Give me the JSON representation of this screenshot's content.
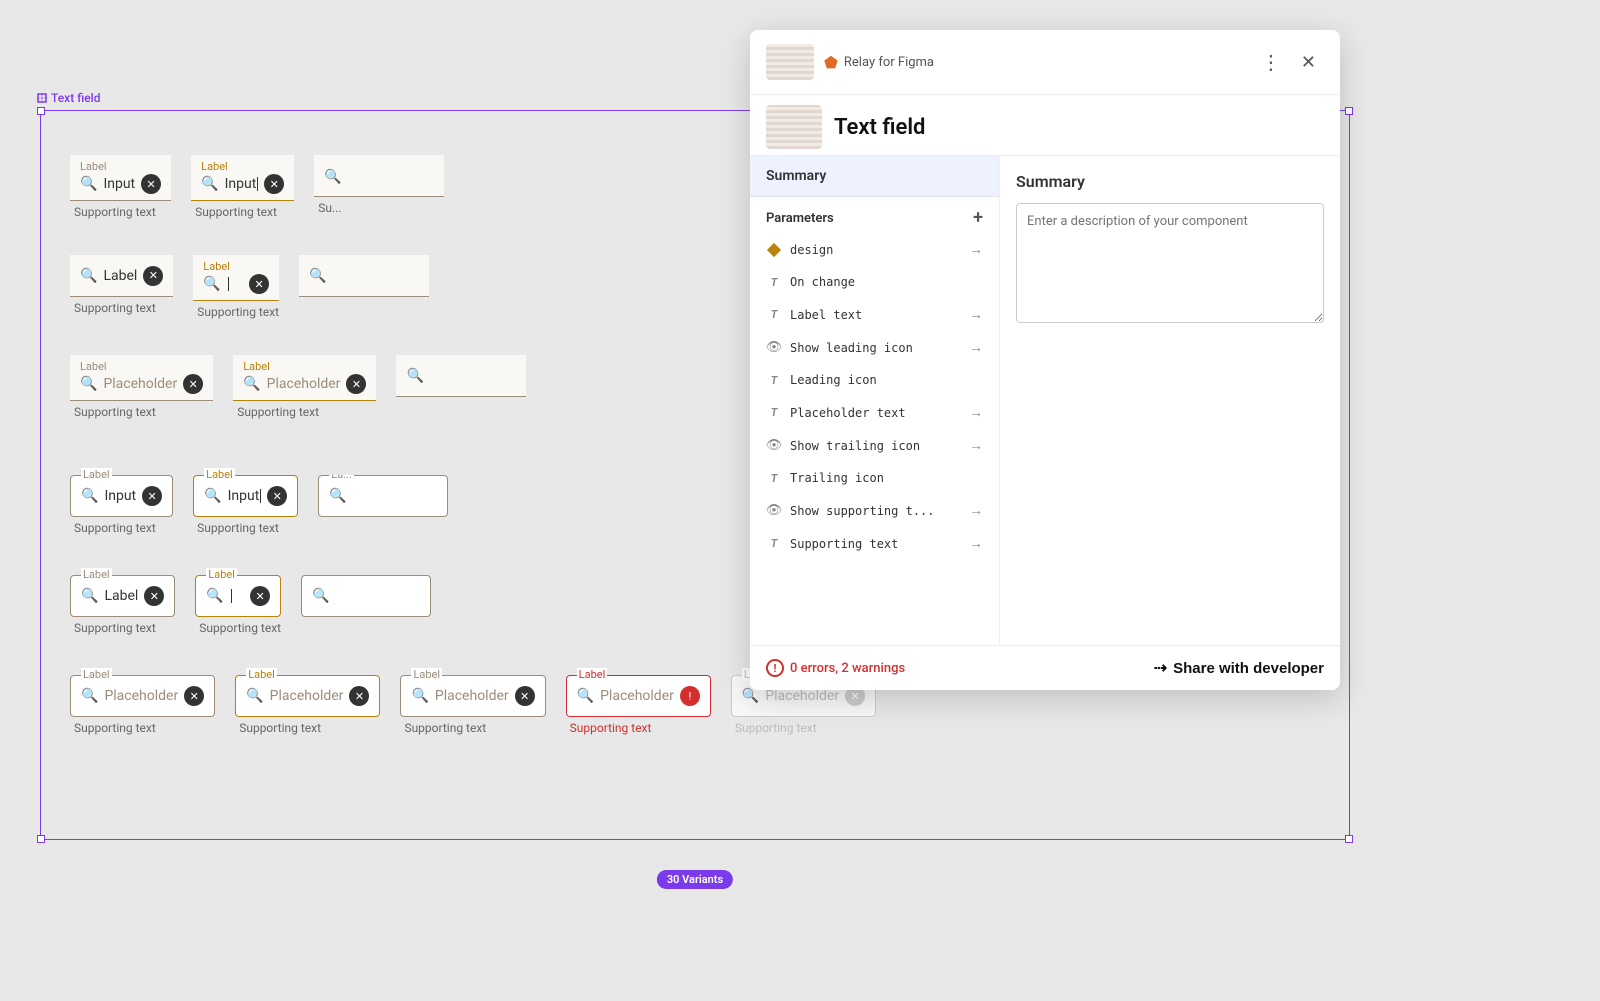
{
  "canvas": {
    "background": "#e8e8e8",
    "frame_label": "Text field"
  },
  "variants_badge": "30 Variants",
  "text_fields": {
    "rows": [
      {
        "row_index": 0,
        "fields": [
          {
            "type": "filled",
            "label": "Label",
            "value": "Input",
            "has_icon": true,
            "has_clear": true,
            "supporting": "Supporting text",
            "state": "default"
          },
          {
            "type": "filled",
            "label": "Label",
            "value": "Input",
            "has_icon": true,
            "has_clear": true,
            "supporting": "Supporting text",
            "state": "focused"
          },
          {
            "type": "filled",
            "label": "",
            "value": "Su...",
            "has_icon": true,
            "has_clear": true,
            "supporting": "",
            "state": "default",
            "truncated": true
          }
        ]
      },
      {
        "row_index": 1,
        "fields": [
          {
            "type": "filled",
            "label": "Label",
            "value": "Label",
            "has_icon": true,
            "has_clear": true,
            "supporting": "Supporting text",
            "state": "default"
          },
          {
            "type": "filled",
            "label": "Label",
            "value": "",
            "has_icon": true,
            "has_clear": true,
            "supporting": "Supporting text",
            "state": "focused"
          },
          {
            "type": "filled",
            "label": "",
            "value": "",
            "has_icon": true,
            "has_clear": true,
            "supporting": "",
            "state": "default",
            "truncated": true
          }
        ]
      },
      {
        "row_index": 2,
        "fields": [
          {
            "type": "filled",
            "label": "Label",
            "value": "Placeholder",
            "has_icon": true,
            "has_clear": true,
            "supporting": "Supporting text",
            "state": "default",
            "is_placeholder": true
          },
          {
            "type": "filled",
            "label": "Label",
            "value": "Placeholder",
            "has_icon": true,
            "has_clear": true,
            "supporting": "Supporting text",
            "state": "focused",
            "is_placeholder": true
          },
          {
            "type": "filled",
            "label": "",
            "value": "",
            "has_icon": true,
            "has_clear": true,
            "supporting": "",
            "state": "default",
            "truncated": true
          }
        ]
      },
      {
        "row_index": 3,
        "is_spacer": true
      },
      {
        "row_index": 4,
        "fields": [
          {
            "type": "outlined",
            "label": "Label",
            "value": "Input",
            "has_icon": true,
            "has_clear": true,
            "supporting": "Supporting text",
            "state": "default"
          },
          {
            "type": "outlined",
            "label": "Label",
            "value": "Input",
            "has_icon": true,
            "has_clear": true,
            "supporting": "Supporting text",
            "state": "focused"
          },
          {
            "type": "outlined",
            "label": "La...",
            "value": "",
            "has_icon": true,
            "has_clear": true,
            "supporting": "",
            "state": "default",
            "truncated": true
          }
        ]
      },
      {
        "row_index": 5,
        "fields": [
          {
            "type": "outlined",
            "label": "Label",
            "value": "Label",
            "has_icon": true,
            "has_clear": true,
            "supporting": "Supporting text",
            "state": "default"
          },
          {
            "type": "outlined",
            "label": "Label",
            "value": "",
            "has_icon": true,
            "has_clear": true,
            "supporting": "Supporting text",
            "state": "focused"
          },
          {
            "type": "outlined",
            "label": "",
            "value": "",
            "has_icon": true,
            "has_clear": true,
            "supporting": "",
            "state": "default",
            "truncated": true
          }
        ]
      },
      {
        "row_index": 6,
        "fields": [
          {
            "type": "outlined",
            "label": "Label",
            "value": "Placeholder",
            "has_icon": true,
            "has_clear": true,
            "supporting": "Supporting text",
            "state": "default",
            "is_placeholder": true
          },
          {
            "type": "outlined",
            "label": "Label",
            "value": "Placeholder",
            "has_icon": true,
            "has_clear": true,
            "supporting": "Supporting text",
            "state": "focused",
            "is_placeholder": true
          },
          {
            "type": "outlined",
            "label": "Label",
            "value": "Placeholder",
            "has_icon": true,
            "has_clear": true,
            "supporting": "Supporting text",
            "state": "default",
            "is_placeholder": true
          },
          {
            "type": "outlined",
            "label": "Label",
            "value": "Placeholder",
            "has_icon": true,
            "has_clear": true,
            "supporting": "Supporting text",
            "state": "error",
            "is_placeholder": true
          },
          {
            "type": "outlined",
            "label": "Label",
            "value": "Placeholder",
            "has_icon": true,
            "has_clear": true,
            "supporting": "Supporting text",
            "state": "disabled",
            "is_placeholder": true
          }
        ]
      }
    ]
  },
  "panel": {
    "title": "Text field",
    "menu_icon": "⋮",
    "close_icon": "✕",
    "relay_label": "Relay for Figma",
    "left_tab": "Summary",
    "params_title": "Parameters",
    "params_add_icon": "+",
    "params": [
      {
        "type": "diamond",
        "name": "design",
        "has_arrow": true
      },
      {
        "type": "text",
        "name": "On change",
        "has_arrow": false
      },
      {
        "type": "text",
        "name": "Label text",
        "has_arrow": true
      },
      {
        "type": "eye",
        "name": "Show leading icon",
        "has_arrow": true
      },
      {
        "type": "text",
        "name": "Leading icon",
        "has_arrow": false
      },
      {
        "type": "text",
        "name": "Placeholder text",
        "has_arrow": true
      },
      {
        "type": "eye",
        "name": "Show trailing icon",
        "has_arrow": true
      },
      {
        "type": "text",
        "name": "Trailing icon",
        "has_arrow": false
      },
      {
        "type": "eye",
        "name": "Show supporting t...",
        "has_arrow": true
      },
      {
        "type": "text",
        "name": "Supporting text",
        "has_arrow": true
      }
    ],
    "right_title": "Summary",
    "description_placeholder": "Enter a description of your component",
    "footer": {
      "warnings_text": "0 errors, 2 warnings",
      "share_label": "Share with developer"
    }
  }
}
